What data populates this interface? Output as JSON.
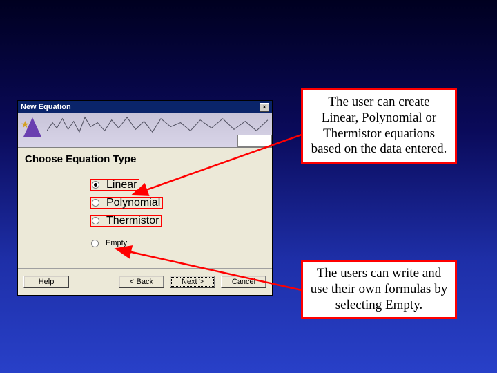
{
  "dialog": {
    "title": "New Equation",
    "heading": "Choose Equation Type",
    "options": {
      "linear": "Linear",
      "polynomial": "Polynomial",
      "thermistor": "Thermistor",
      "empty": "Empty"
    },
    "buttons": {
      "help": "Help",
      "back": "< Back",
      "next": "Next >",
      "cancel": "Cancel"
    },
    "selected": "linear"
  },
  "callouts": {
    "top": "The user can create Linear, Polynomial or Thermistor equations based on the data entered.",
    "bottom": "The users can write and use their own formulas by selecting Empty."
  }
}
